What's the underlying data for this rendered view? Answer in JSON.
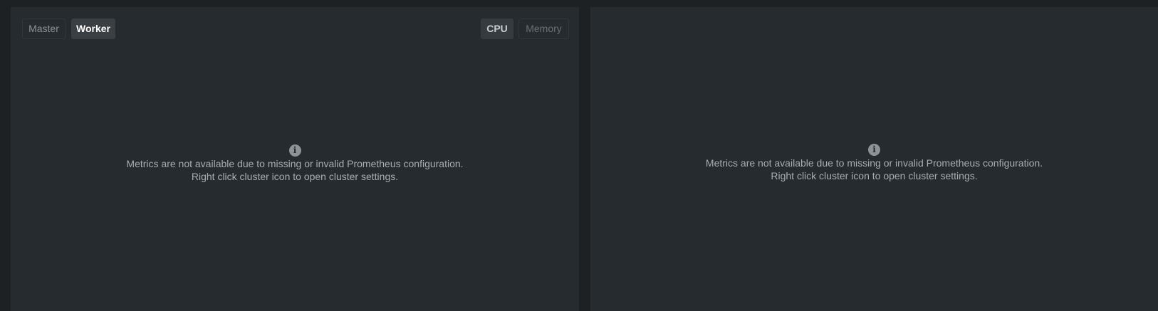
{
  "left_panel": {
    "node_tabs": [
      {
        "label": "Master",
        "selected": false
      },
      {
        "label": "Worker",
        "selected": true
      }
    ],
    "metric_tabs": [
      {
        "label": "CPU",
        "selected": true
      },
      {
        "label": "Memory",
        "selected": false
      }
    ],
    "notice": {
      "icon": "info-icon",
      "icon_glyph": "i",
      "line1": "Metrics are not available due to missing or invalid Prometheus configuration.",
      "line2": "Right click cluster icon to open cluster settings."
    }
  },
  "right_panel": {
    "notice": {
      "icon": "info-icon",
      "icon_glyph": "i",
      "line1": "Metrics are not available due to missing or invalid Prometheus configuration.",
      "line2": "Right click cluster icon to open cluster settings."
    }
  }
}
